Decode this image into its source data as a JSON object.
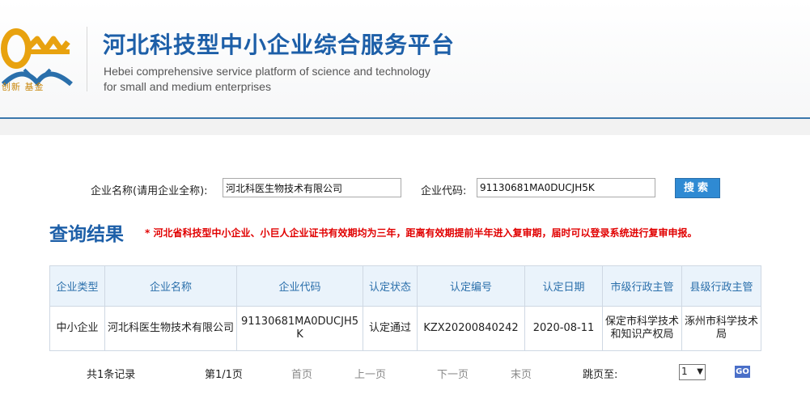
{
  "header": {
    "title_cn": "河北科技型中小企业综合服务平台",
    "title_en_line1": "Hebei  comprehensive service platform of science and technology",
    "title_en_line2": "for small and medium enterprises",
    "logo_text": "创新 基金"
  },
  "search": {
    "company_name_label": "企业名称(请用企业全称):",
    "company_name_value": "河北科医生物技术有限公司",
    "company_code_label": "企业代码:",
    "company_code_value": "91130681MA0DUCJH5K",
    "search_button": "搜索"
  },
  "results": {
    "title": "查询结果",
    "note": "* 河北省科技型中小企业、小巨人企业证书有效期均为三年，距离有效期提前半年进入复审期，届时可以登录系统进行复审申报。",
    "columns": [
      "企业类型",
      "企业名称",
      "企业代码",
      "认定状态",
      "认定编号",
      "认定日期",
      "市级行政主管",
      "县级行政主管"
    ],
    "rows": [
      [
        "中小企业",
        "河北科医生物技术有限公司",
        "91130681MA0DUCJH5K",
        "认定通过",
        "KZX20200840242",
        "2020-08-11",
        "保定市科学技术和知识产权局",
        "涿州市科学技术局"
      ]
    ]
  },
  "pager": {
    "total": "共1条记录",
    "page": "第1/1页",
    "first": "首页",
    "prev": "上一页",
    "next": "下一页",
    "last": "末页",
    "jump_label": "跳页至:",
    "selected_page": "1",
    "go": "GO"
  },
  "colors": {
    "brand_blue": "#1d5fa8",
    "header_rule": "#3a78ac",
    "note_red": "#e10000",
    "status_green": "#229a24",
    "button_blue": "#2f8ad3",
    "logo_gold": "#e8a20f"
  }
}
